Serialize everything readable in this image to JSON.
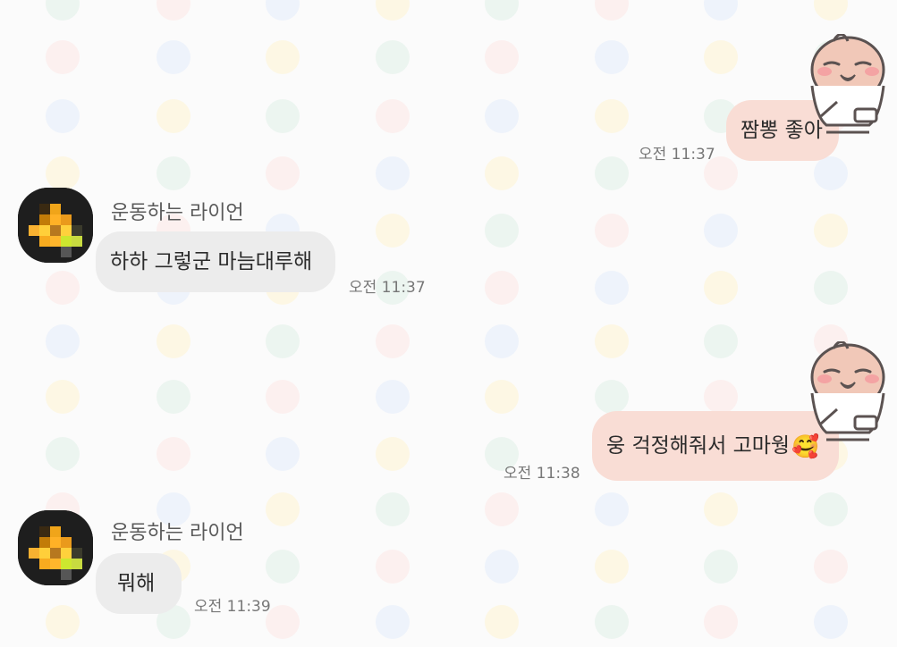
{
  "theme": {
    "background": "#fbfbfb",
    "incoming_bubble": "#ececec",
    "outgoing_bubble": "#f9ddd5",
    "dot_colors": [
      "#d9ede3",
      "#fde2df",
      "#dde9fb",
      "#fff2c7"
    ]
  },
  "messages": [
    {
      "side": "outgoing",
      "text": "짬뽕 좋아",
      "time": "오전 11:37",
      "sticker_icon": "peach-character-icon"
    },
    {
      "side": "incoming",
      "sender": "운동하는 라이언",
      "avatar_icon": "pixelated-avatar-icon",
      "text": "하하 그렇군 마늠대루해",
      "time": "오전 11:37"
    },
    {
      "side": "outgoing",
      "text": "웅 걱정해줘서 고마웡",
      "emoji": "🥰",
      "time": "오전 11:38",
      "sticker_icon": "peach-character-icon"
    },
    {
      "side": "incoming",
      "sender": "운동하는 라이언",
      "avatar_icon": "pixelated-avatar-icon",
      "text": "뭐해",
      "time": "오전 11:39"
    }
  ]
}
